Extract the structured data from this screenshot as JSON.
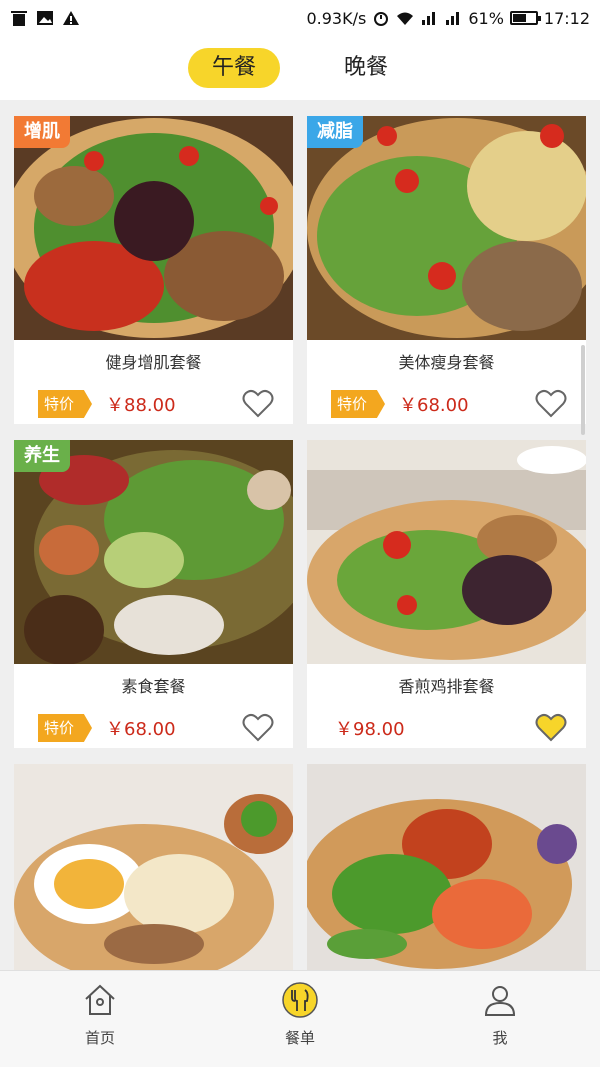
{
  "status_bar": {
    "speed": "0.93K/s",
    "battery": "61%",
    "battery_level": 0.61,
    "time": "17:12"
  },
  "tabs": [
    {
      "label": "午餐",
      "active": true
    },
    {
      "label": "晚餐",
      "active": false
    }
  ],
  "cards": [
    {
      "tag": "增肌",
      "tag_color": "#f27a34",
      "name": "健身增肌套餐",
      "sale": "特价",
      "price": "￥88.00",
      "favorited": false
    },
    {
      "tag": "减脂",
      "tag_color": "#3ba7e8",
      "name": "美体瘦身套餐",
      "sale": "特价",
      "price": "￥68.00",
      "favorited": false
    },
    {
      "tag": "养生",
      "tag_color": "#6ab04a",
      "name": "素食套餐",
      "sale": "特价",
      "price": "￥68.00",
      "favorited": false
    },
    {
      "tag": "",
      "name": "香煎鸡排套餐",
      "sale": "",
      "price": "￥98.00",
      "favorited": true
    }
  ],
  "bottom_nav": [
    {
      "label": "首页",
      "icon": "home-icon",
      "active": false
    },
    {
      "label": "餐单",
      "icon": "fork-knife-icon",
      "active": true
    },
    {
      "label": "我",
      "icon": "user-icon",
      "active": false
    }
  ],
  "colors": {
    "accent": "#f7d52a",
    "price": "#cc2a1a",
    "sale_badge": "#f3a71f",
    "heart_filled": "#f7d52a"
  }
}
